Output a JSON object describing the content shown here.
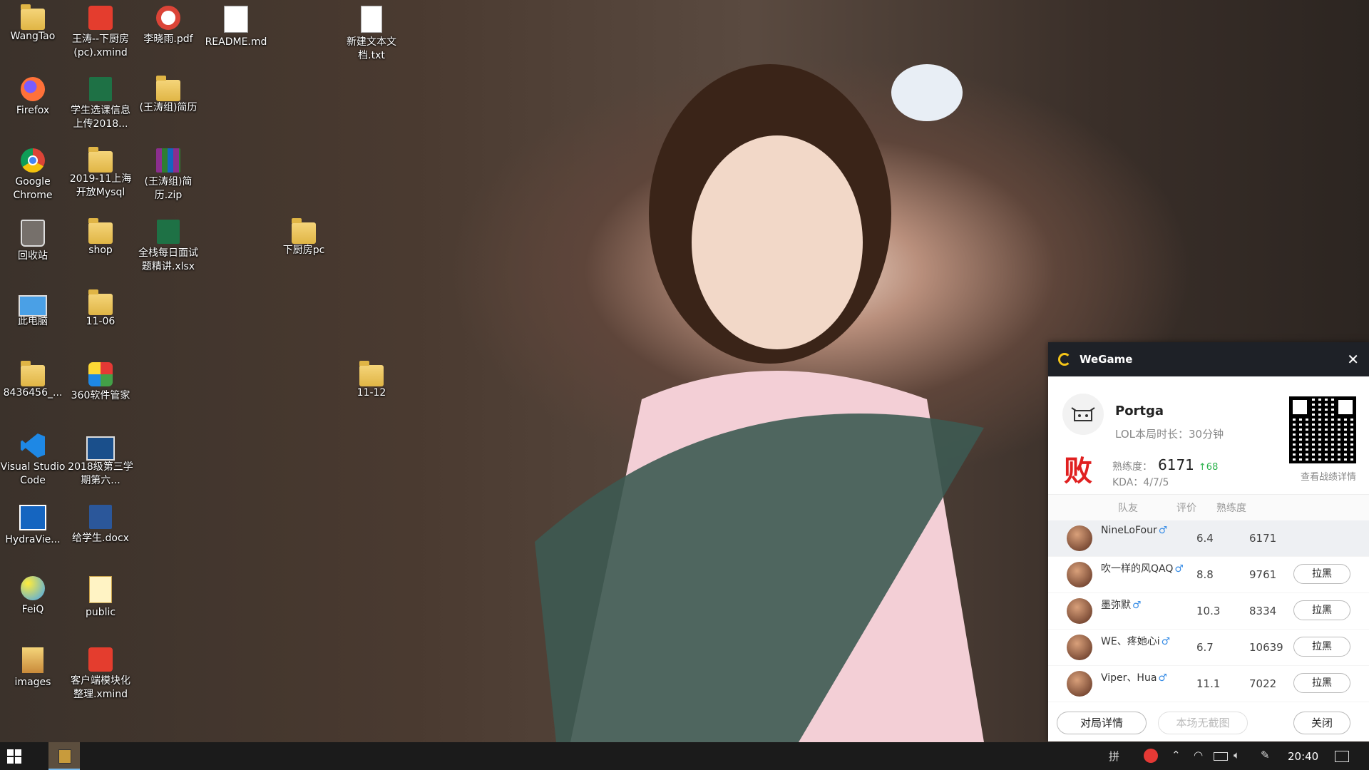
{
  "desktop_icons": [
    {
      "label": "WangTao",
      "type": "folder"
    },
    {
      "label": "王涛--下厨房(pc).xmind",
      "type": "xmind"
    },
    {
      "label": "李晓雨.pdf",
      "type": "pdf"
    },
    {
      "label": "README.md",
      "type": "md"
    },
    {
      "label": "新建文本文档.txt",
      "type": "doc"
    },
    {
      "label": "Firefox",
      "type": "firefox"
    },
    {
      "label": "学生选课信息上传2018...",
      "type": "xlsx"
    },
    {
      "label": "(王涛组)简历",
      "type": "folder"
    },
    {
      "label": "Google Chrome",
      "type": "chrome"
    },
    {
      "label": "2019-11上海开放Mysql",
      "type": "folder"
    },
    {
      "label": "(王涛组)简历.zip",
      "type": "zip"
    },
    {
      "label": "回收站",
      "type": "recycle"
    },
    {
      "label": "shop",
      "type": "folder"
    },
    {
      "label": "全栈每日面试题精讲.xlsx",
      "type": "xlsx"
    },
    {
      "label": "下厨房pc",
      "type": "folder"
    },
    {
      "label": "此电脑",
      "type": "pc"
    },
    {
      "label": "11-06",
      "type": "folder"
    },
    {
      "label": "8436456_...",
      "type": "folder"
    },
    {
      "label": "360软件管家",
      "type": "win360"
    },
    {
      "label": "11-12",
      "type": "folder"
    },
    {
      "label": "Visual Studio Code",
      "type": "vscode"
    },
    {
      "label": "2018级第三学期第六...",
      "type": "ppt"
    },
    {
      "label": "HydraVie...",
      "type": "hydra"
    },
    {
      "label": "给学生.docx",
      "type": "docx"
    },
    {
      "label": "FeiQ",
      "type": "feiq"
    },
    {
      "label": "public",
      "type": "public"
    },
    {
      "label": "images",
      "type": "images"
    },
    {
      "label": "客户端模块化整理.xmind",
      "type": "xmind"
    }
  ],
  "wegame": {
    "title": "WeGame",
    "close": "✕",
    "player": {
      "name": "Portga",
      "duration": "LOL本局时长：30分钟",
      "result": "败",
      "proficiency_label": "熟练度：",
      "proficiency_value": "6171",
      "proficiency_delta": "↑68",
      "kda": "KDA：4/7/5",
      "qr_label": "查看战绩详情"
    },
    "table_headers": {
      "team": "队友",
      "score": "评价",
      "proficiency": "熟练度"
    },
    "teammates": [
      {
        "name": "NineLoFour",
        "score": "6.4",
        "proficiency": "6171",
        "action": ""
      },
      {
        "name": "吹一样的风QAQ",
        "score": "8.8",
        "proficiency": "9761",
        "action": "拉黑"
      },
      {
        "name": "墨弥默",
        "score": "10.3",
        "proficiency": "8334",
        "action": "拉黑"
      },
      {
        "name": "WE、疼她心i",
        "score": "6.7",
        "proficiency": "10639",
        "action": "拉黑"
      },
      {
        "name": "Viper、Hua",
        "score": "11.1",
        "proficiency": "7022",
        "action": "拉黑"
      }
    ],
    "male_symbol": "♂",
    "footer": {
      "detail": "对局详情",
      "screenshot": "本场无截图",
      "close": "关闭"
    }
  },
  "taskbar": {
    "clock": "20:40",
    "tray_icons": [
      "input-method-icon",
      "360-icon",
      "chevron-up-icon",
      "wifi-icon",
      "battery-icon",
      "volume-icon",
      "pen-icon",
      "notification-icon"
    ],
    "input_method": "拼"
  }
}
